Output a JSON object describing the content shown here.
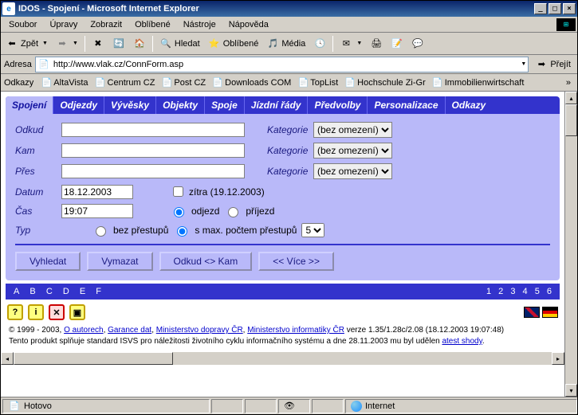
{
  "window": {
    "title": "IDOS - Spojení - Microsoft Internet Explorer"
  },
  "menu": {
    "items": [
      "Soubor",
      "Úpravy",
      "Zobrazit",
      "Oblíbené",
      "Nástroje",
      "Nápověda"
    ]
  },
  "toolbar": {
    "back": "Zpět",
    "search": "Hledat",
    "favorites": "Oblíbené",
    "media": "Média"
  },
  "address": {
    "label": "Adresa",
    "url": "http://www.vlak.cz/ConnForm.asp",
    "go": "Přejít"
  },
  "links": {
    "label": "Odkazy",
    "items": [
      "AltaVista",
      "Centrum CZ",
      "Post CZ",
      "Downloads COM",
      "TopList",
      "Hochschule Zi-Gr",
      "Immobilienwirtschaft"
    ]
  },
  "tabs": {
    "items": [
      "Spojení",
      "Odjezdy",
      "Vývěsky",
      "Objekty",
      "Spoje",
      "Jízdní řády",
      "Předvolby",
      "Personalizace",
      "Odkazy"
    ],
    "active_index": 0
  },
  "form": {
    "odkud_label": "Odkud",
    "kam_label": "Kam",
    "pres_label": "Přes",
    "datum_label": "Datum",
    "cas_label": "Čas",
    "typ_label": "Typ",
    "kategorie_label": "Kategorie",
    "kategorie_value": "(bez omezení)",
    "odkud_value": "",
    "kam_value": "",
    "pres_value": "",
    "datum_value": "18.12.2003",
    "cas_value": "19:07",
    "zitra_label": "zítra (19.12.2003)",
    "odjezd_label": "odjezd",
    "prijezd_label": "příjezd",
    "bez_prestupu_label": "bez přestupů",
    "max_prestupu_label": "s max. počtem přestupů",
    "max_prestupu_value": "5"
  },
  "buttons": {
    "vyhledat": "Vyhledat",
    "vymazat": "Vymazat",
    "odkudkam": "Odkud <> Kam",
    "vice": "<< Více >>"
  },
  "bluestrip": {
    "letters": [
      "A",
      "B",
      "C",
      "D",
      "E",
      "F"
    ],
    "nums": [
      "1",
      "2",
      "3",
      "4",
      "5",
      "6"
    ]
  },
  "footer": {
    "copy_prefix": "© 1999 - 2003, ",
    "link_autorech": "O autorech",
    "link_garance": "Garance dat",
    "link_min_dopravy": "Ministerstvo dopravy ČR",
    "link_min_inf": "Ministerstvo informatiky ČR",
    "version_suffix": " verze 1.35/1.28c/2.08 (18.12.2003 19:07:48)",
    "line2_prefix": "Tento produkt splňuje standard ISVS pro náležitosti životního cyklu informačního systému a dne 28.11.2003 mu byl udělen ",
    "link_atest": "atest shody",
    "line2_suffix": "."
  },
  "status": {
    "hotovo": "Hotovo",
    "zone": "Internet"
  }
}
